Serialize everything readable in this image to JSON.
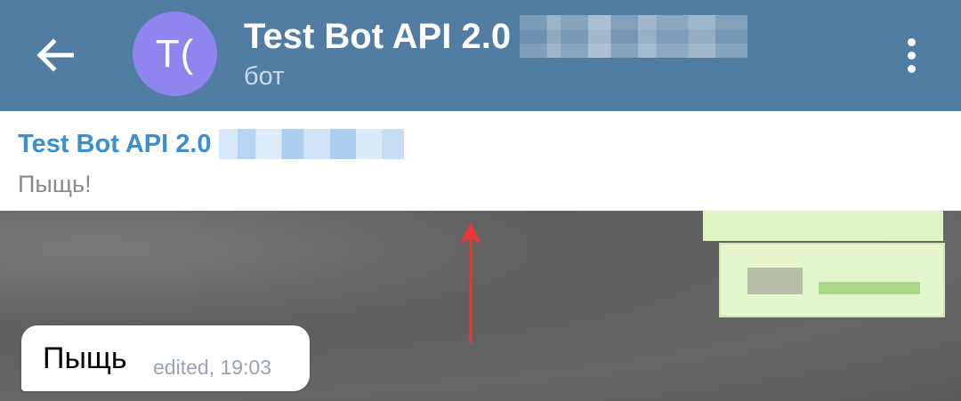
{
  "header": {
    "back_icon": "arrow-left-icon",
    "avatar_initials": "T(",
    "avatar_color": "#8e85ee",
    "title": "Test Bot API 2.0",
    "subtitle": "бот",
    "menu_icon": "more-vertical-icon",
    "background": "#527da3"
  },
  "pinned": {
    "title": "Test Bot API 2.0",
    "text": "Пыщь!",
    "title_color": "#3a8fd0"
  },
  "messages": [
    {
      "text": "Пыщь",
      "meta": "edited, 19:03"
    }
  ]
}
